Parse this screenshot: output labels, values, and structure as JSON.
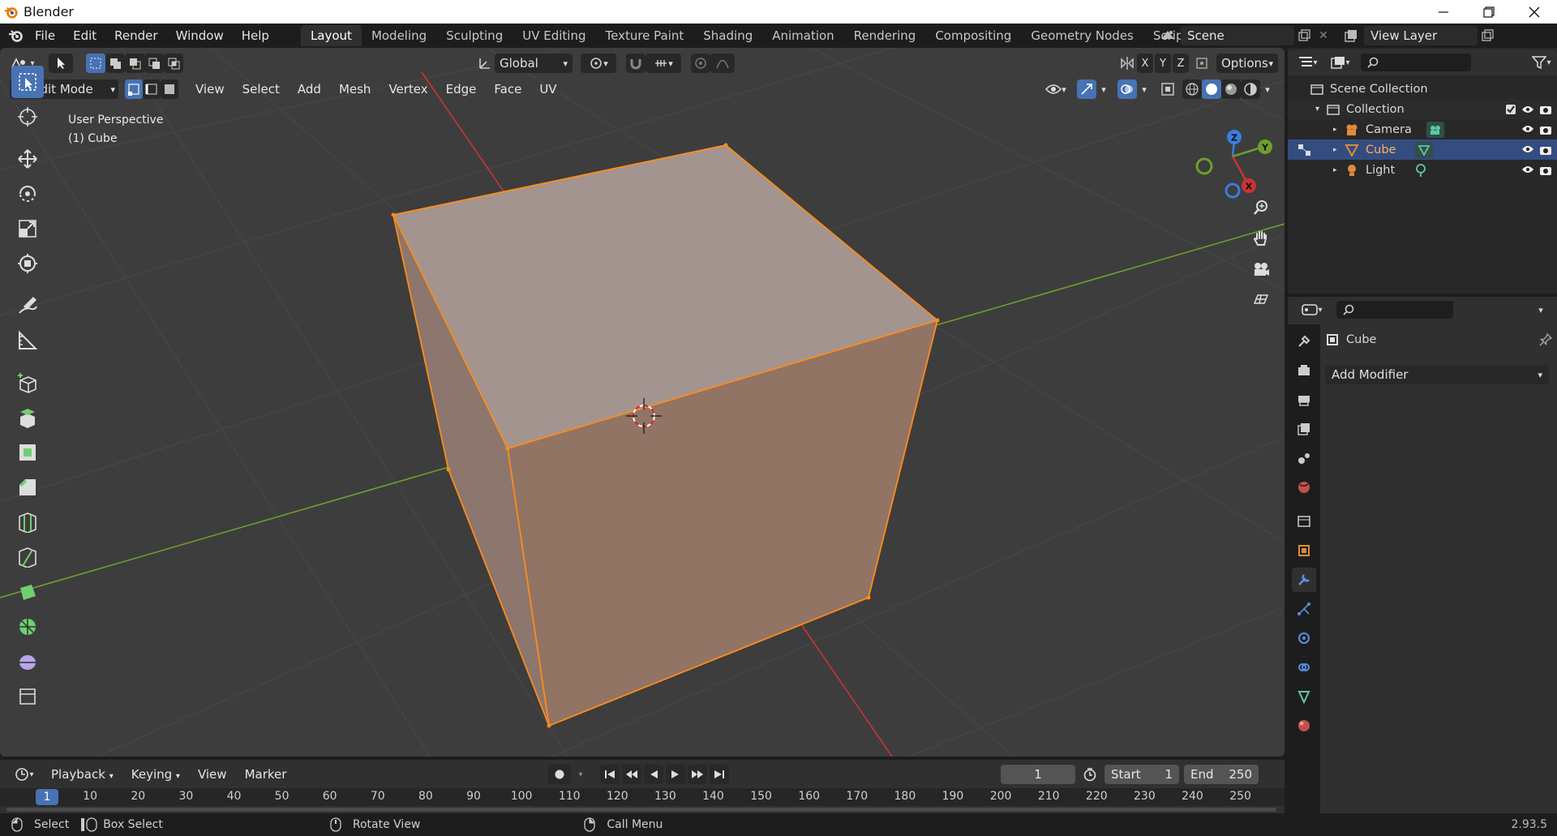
{
  "window": {
    "title": "Blender"
  },
  "topbar": {
    "menus": [
      "File",
      "Edit",
      "Render",
      "Window",
      "Help"
    ],
    "workspaces": [
      "Layout",
      "Modeling",
      "Sculpting",
      "UV Editing",
      "Texture Paint",
      "Shading",
      "Animation",
      "Rendering",
      "Compositing",
      "Geometry Nodes",
      "Scripting"
    ],
    "active_workspace": "Layout",
    "scene": "Scene",
    "view_layer": "View Layer"
  },
  "viewport": {
    "transform_orientation": "Global",
    "axes": [
      "X",
      "Y",
      "Z"
    ],
    "options_label": "Options",
    "mode": "Edit Mode",
    "menus": [
      "View",
      "Select",
      "Add",
      "Mesh",
      "Vertex",
      "Edge",
      "Face",
      "UV"
    ],
    "overlay_text": {
      "perspective": "User Perspective",
      "object": "(1) Cube"
    },
    "gizmo": {
      "x": "X",
      "y": "Y",
      "z": "Z"
    },
    "colors": {
      "background": "#3d3d3d",
      "selection": "#ff8c1a",
      "x_axis": "#cc3333",
      "y_axis": "#6e9e2e",
      "active_tool": "#4772b3"
    }
  },
  "toolbar": {
    "tools": [
      "select-box-icon",
      "cursor-icon",
      "move-icon",
      "rotate-icon",
      "scale-icon",
      "transform-icon",
      "annotate-icon",
      "measure-icon",
      "add-cube-icon",
      "extrude-icon",
      "inset-icon",
      "bevel-icon",
      "loop-cut-icon",
      "knife-icon",
      "poly-build-icon",
      "spin-icon",
      "smooth-icon",
      "edge-slide-icon"
    ]
  },
  "outliner": {
    "root": "Scene Collection",
    "collection": "Collection",
    "items": [
      {
        "label": "Camera",
        "selected": false
      },
      {
        "label": "Cube",
        "selected": true
      },
      {
        "label": "Light",
        "selected": false
      }
    ]
  },
  "properties": {
    "object_name": "Cube",
    "add_modifier": "Add Modifier",
    "tabs": [
      "tool-icon",
      "render-icon",
      "output-icon",
      "view-layer-icon",
      "scene-icon",
      "world-icon",
      "collection-icon",
      "object-icon",
      "modifier-icon",
      "particles-icon",
      "physics-icon",
      "constraints-icon",
      "data-icon",
      "material-icon"
    ]
  },
  "timeline": {
    "menus": [
      "Playback",
      "Keying",
      "View",
      "Marker"
    ],
    "current_frame": "1",
    "start_label": "Start",
    "start": "1",
    "end_label": "End",
    "end": "250",
    "ruler": [
      "1",
      "10",
      "20",
      "30",
      "40",
      "50",
      "60",
      "70",
      "80",
      "90",
      "100",
      "110",
      "120",
      "130",
      "140",
      "150",
      "160",
      "170",
      "180",
      "190",
      "200",
      "210",
      "220",
      "230",
      "240",
      "250"
    ]
  },
  "statusbar": {
    "select": "Select",
    "box_select": "Box Select",
    "rotate_view": "Rotate View",
    "call_menu": "Call Menu",
    "version": "2.93.5"
  }
}
